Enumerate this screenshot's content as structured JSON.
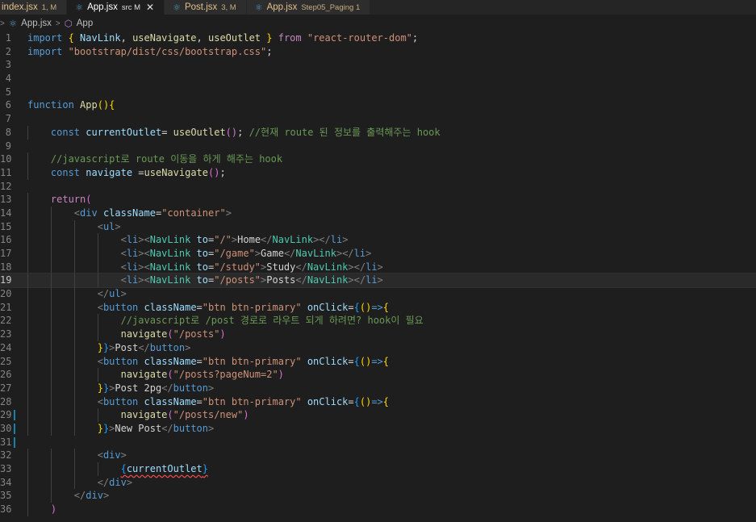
{
  "tabs": [
    {
      "name": "index.jsx",
      "desc": "1, M",
      "active": false
    },
    {
      "name": "App.jsx",
      "desc": "src M",
      "active": true
    },
    {
      "name": "Post.jsx",
      "desc": "3, M",
      "active": false
    },
    {
      "name": "App.jsx",
      "desc": "Step05_Paging 1",
      "active": false
    }
  ],
  "breadcrumb": {
    "file": "App.jsx",
    "symbol": "App"
  },
  "editor": {
    "current_line": 19,
    "modified_lines": [
      29,
      30,
      31
    ],
    "lines": [
      [
        [
          "kw",
          "import "
        ],
        [
          "b1",
          "{ "
        ],
        [
          "var",
          "NavLink"
        ],
        [
          "txt",
          ", "
        ],
        [
          "fn",
          "useNavigate"
        ],
        [
          "txt",
          ", "
        ],
        [
          "fn",
          "useOutlet"
        ],
        [
          "b1",
          " } "
        ],
        [
          "ctrl",
          "from "
        ],
        [
          "str",
          "\"react-router-dom\""
        ],
        [
          "txt",
          ";"
        ]
      ],
      [
        [
          "kw",
          "import "
        ],
        [
          "str",
          "\"bootstrap/dist/css/bootstrap.css\""
        ],
        [
          "txt",
          ";"
        ]
      ],
      [],
      [],
      [],
      [
        [
          "kw",
          "function "
        ],
        [
          "fn",
          "App"
        ],
        [
          "b1",
          "(){"
        ]
      ],
      [],
      [
        [
          "txt",
          "    "
        ],
        [
          "kw",
          "const "
        ],
        [
          "var",
          "currentOutlet"
        ],
        [
          "txt",
          "= "
        ],
        [
          "fn",
          "useOutlet"
        ],
        [
          "b2",
          "()"
        ],
        [
          "txt",
          "; "
        ],
        [
          "cmt",
          "//현재 route 된 정보를 출력해주는 hook"
        ]
      ],
      [],
      [
        [
          "txt",
          "    "
        ],
        [
          "cmt",
          "//javascript로 route 이동을 하게 해주는 hook"
        ]
      ],
      [
        [
          "txt",
          "    "
        ],
        [
          "kw",
          "const "
        ],
        [
          "var",
          "navigate "
        ],
        [
          "txt",
          "="
        ],
        [
          "fn",
          "useNavigate"
        ],
        [
          "b2",
          "()"
        ],
        [
          "txt",
          ";"
        ]
      ],
      [],
      [
        [
          "txt",
          "    "
        ],
        [
          "ctrl",
          "return"
        ],
        [
          "b2",
          "("
        ]
      ],
      [
        [
          "txt",
          "        "
        ],
        [
          "punct",
          "<"
        ],
        [
          "tag",
          "div "
        ],
        [
          "attr",
          "className"
        ],
        [
          "txt",
          "="
        ],
        [
          "str",
          "\"container\""
        ],
        [
          "punct",
          ">"
        ]
      ],
      [
        [
          "txt",
          "            "
        ],
        [
          "punct",
          "<"
        ],
        [
          "tag",
          "ul"
        ],
        [
          "punct",
          ">"
        ]
      ],
      [
        [
          "txt",
          "                "
        ],
        [
          "punct",
          "<"
        ],
        [
          "tag",
          "li"
        ],
        [
          "punct",
          "><"
        ],
        [
          "comp",
          "NavLink "
        ],
        [
          "attr",
          "to"
        ],
        [
          "txt",
          "="
        ],
        [
          "str",
          "\"/\""
        ],
        [
          "punct",
          ">"
        ],
        [
          "txt",
          "Home"
        ],
        [
          "punct",
          "</"
        ],
        [
          "comp",
          "NavLink"
        ],
        [
          "punct",
          "></"
        ],
        [
          "tag",
          "li"
        ],
        [
          "punct",
          ">"
        ]
      ],
      [
        [
          "txt",
          "                "
        ],
        [
          "punct",
          "<"
        ],
        [
          "tag",
          "li"
        ],
        [
          "punct",
          "><"
        ],
        [
          "comp",
          "NavLink "
        ],
        [
          "attr",
          "to"
        ],
        [
          "txt",
          "="
        ],
        [
          "str",
          "\"/game\""
        ],
        [
          "punct",
          ">"
        ],
        [
          "txt",
          "Game"
        ],
        [
          "punct",
          "</"
        ],
        [
          "comp",
          "NavLink"
        ],
        [
          "punct",
          "></"
        ],
        [
          "tag",
          "li"
        ],
        [
          "punct",
          ">"
        ]
      ],
      [
        [
          "txt",
          "                "
        ],
        [
          "punct",
          "<"
        ],
        [
          "tag",
          "li"
        ],
        [
          "punct",
          "><"
        ],
        [
          "comp",
          "NavLink "
        ],
        [
          "attr",
          "to"
        ],
        [
          "txt",
          "="
        ],
        [
          "str",
          "\"/study\""
        ],
        [
          "punct",
          ">"
        ],
        [
          "txt",
          "Study"
        ],
        [
          "punct",
          "</"
        ],
        [
          "comp",
          "NavLink"
        ],
        [
          "punct",
          "></"
        ],
        [
          "tag",
          "li"
        ],
        [
          "punct",
          ">"
        ]
      ],
      [
        [
          "txt",
          "                "
        ],
        [
          "punct",
          "<"
        ],
        [
          "tag",
          "li"
        ],
        [
          "punct",
          "><"
        ],
        [
          "comp",
          "NavLink "
        ],
        [
          "attr",
          "to"
        ],
        [
          "txt",
          "="
        ],
        [
          "str",
          "\"/posts\""
        ],
        [
          "punct",
          ">"
        ],
        [
          "txt",
          "Posts"
        ],
        [
          "punct",
          "</"
        ],
        [
          "comp",
          "NavLink"
        ],
        [
          "punct",
          "></"
        ],
        [
          "tag",
          "li"
        ],
        [
          "punct",
          ">"
        ]
      ],
      [
        [
          "txt",
          "            "
        ],
        [
          "punct",
          "</"
        ],
        [
          "tag",
          "ul"
        ],
        [
          "punct",
          ">"
        ]
      ],
      [
        [
          "txt",
          "            "
        ],
        [
          "punct",
          "<"
        ],
        [
          "tag",
          "button "
        ],
        [
          "attr",
          "className"
        ],
        [
          "txt",
          "="
        ],
        [
          "str",
          "\"btn btn-primary\" "
        ],
        [
          "attr",
          "onClick"
        ],
        [
          "txt",
          "="
        ],
        [
          "b3",
          "{"
        ],
        [
          "b1",
          "()"
        ],
        [
          "kw",
          "=>"
        ],
        [
          "b1",
          "{"
        ]
      ],
      [
        [
          "txt",
          "                "
        ],
        [
          "cmt",
          "//javascript로 /post 경로로 라우트 되게 하려면? hook이 필요"
        ]
      ],
      [
        [
          "txt",
          "                "
        ],
        [
          "fn",
          "navigate"
        ],
        [
          "b2",
          "("
        ],
        [
          "str",
          "\"/posts\""
        ],
        [
          "b2",
          ")"
        ]
      ],
      [
        [
          "txt",
          "            "
        ],
        [
          "b1",
          "}"
        ],
        [
          "b3",
          "}"
        ],
        [
          "punct",
          ">"
        ],
        [
          "txt",
          "Post"
        ],
        [
          "punct",
          "</"
        ],
        [
          "tag",
          "button"
        ],
        [
          "punct",
          ">"
        ]
      ],
      [
        [
          "txt",
          "            "
        ],
        [
          "punct",
          "<"
        ],
        [
          "tag",
          "button "
        ],
        [
          "attr",
          "className"
        ],
        [
          "txt",
          "="
        ],
        [
          "str",
          "\"btn btn-primary\" "
        ],
        [
          "attr",
          "onClick"
        ],
        [
          "txt",
          "="
        ],
        [
          "b3",
          "{"
        ],
        [
          "b1",
          "()"
        ],
        [
          "kw",
          "=>"
        ],
        [
          "b1",
          "{"
        ]
      ],
      [
        [
          "txt",
          "                "
        ],
        [
          "fn",
          "navigate"
        ],
        [
          "b2",
          "("
        ],
        [
          "str",
          "\"/posts?pageNum=2\""
        ],
        [
          "b2",
          ")"
        ]
      ],
      [
        [
          "txt",
          "            "
        ],
        [
          "b1",
          "}"
        ],
        [
          "b3",
          "}"
        ],
        [
          "punct",
          ">"
        ],
        [
          "txt",
          "Post 2pg"
        ],
        [
          "punct",
          "</"
        ],
        [
          "tag",
          "button"
        ],
        [
          "punct",
          ">"
        ]
      ],
      [
        [
          "txt",
          "            "
        ],
        [
          "punct",
          "<"
        ],
        [
          "tag",
          "button "
        ],
        [
          "attr",
          "className"
        ],
        [
          "txt",
          "="
        ],
        [
          "str",
          "\"btn btn-primary\" "
        ],
        [
          "attr",
          "onClick"
        ],
        [
          "txt",
          "="
        ],
        [
          "b3",
          "{"
        ],
        [
          "b1",
          "()"
        ],
        [
          "kw",
          "=>"
        ],
        [
          "b1",
          "{"
        ]
      ],
      [
        [
          "txt",
          "                "
        ],
        [
          "fn",
          "navigate"
        ],
        [
          "b2",
          "("
        ],
        [
          "str",
          "\"/posts/new\""
        ],
        [
          "b2",
          ")"
        ]
      ],
      [
        [
          "txt",
          "            "
        ],
        [
          "b1",
          "}"
        ],
        [
          "b3",
          "}"
        ],
        [
          "punct",
          ">"
        ],
        [
          "txt",
          "New Post"
        ],
        [
          "punct",
          "</"
        ],
        [
          "tag",
          "button"
        ],
        [
          "punct",
          ">"
        ]
      ],
      [],
      [
        [
          "txt",
          "            "
        ],
        [
          "punct",
          "<"
        ],
        [
          "tag",
          "div"
        ],
        [
          "punct",
          ">"
        ]
      ],
      [
        [
          "txt",
          "                "
        ],
        [
          "b3",
          "{"
        ],
        [
          "var",
          "currentOutlet"
        ],
        [
          "b3",
          "}"
        ]
      ],
      [
        [
          "txt",
          "            "
        ],
        [
          "punct",
          "</"
        ],
        [
          "tag",
          "div"
        ],
        [
          "punct",
          ">"
        ]
      ],
      [
        [
          "txt",
          "        "
        ],
        [
          "punct",
          "</"
        ],
        [
          "tag",
          "div"
        ],
        [
          "punct",
          ">"
        ]
      ],
      [
        [
          "txt",
          "    "
        ],
        [
          "b2",
          ")"
        ]
      ]
    ]
  }
}
